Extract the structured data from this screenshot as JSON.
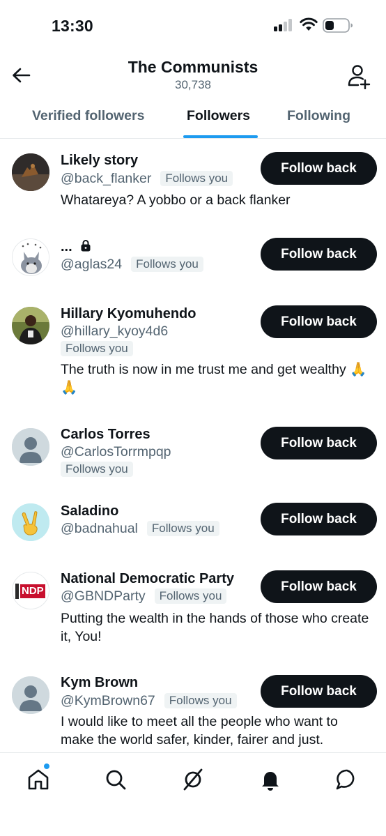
{
  "status_bar": {
    "time": "13:30"
  },
  "header": {
    "title": "The Communists",
    "subtitle": "30,738"
  },
  "tabs": [
    {
      "label": "Verified followers",
      "active": false
    },
    {
      "label": "Followers",
      "active": true
    },
    {
      "label": "Following",
      "active": false
    }
  ],
  "users": [
    {
      "name": "Likely story",
      "handle": "@back_flanker",
      "follows_you": "Follows you",
      "bio": "Whatareya? A yobbo or a back flanker",
      "button": "Follow back"
    },
    {
      "name": "...",
      "handle": "@aglas24",
      "follows_you": "Follows you",
      "bio": "",
      "button": "Follow back"
    },
    {
      "name": "Hillary Kyomuhendo",
      "handle": "@hillary_kyoy4d6",
      "follows_you": "Follows you",
      "bio": "The truth is now in me trust me and get wealthy 🙏🙏",
      "button": "Follow back"
    },
    {
      "name": "Carlos Torres",
      "handle": "@CarlosTorrmpqp",
      "follows_you": "Follows you",
      "bio": "",
      "button": "Follow back"
    },
    {
      "name": "Saladino",
      "handle": "@badnahual",
      "follows_you": "Follows you",
      "bio": "",
      "button": "Follow back"
    },
    {
      "name": "National Democratic Party",
      "handle": "@GBNDParty",
      "follows_you": "Follows you",
      "bio": "Putting the wealth in the hands of those who create it, You!",
      "button": "Follow back"
    },
    {
      "name": "Kym Brown",
      "handle": "@KymBrown67",
      "follows_you": "Follows you",
      "bio": "I would like to meet all the people who want to make the world safer, kinder, fairer and just.",
      "button": "Follow back"
    }
  ],
  "ndp_logo_text": "NDP",
  "bottom_nav": [
    "home-icon",
    "search-icon",
    "grok-icon",
    "notifications-icon",
    "messages-icon"
  ],
  "colors": {
    "accent": "#1d9bf0",
    "text": "#0f1419",
    "secondary": "#536471",
    "button_bg": "#0f1419"
  }
}
